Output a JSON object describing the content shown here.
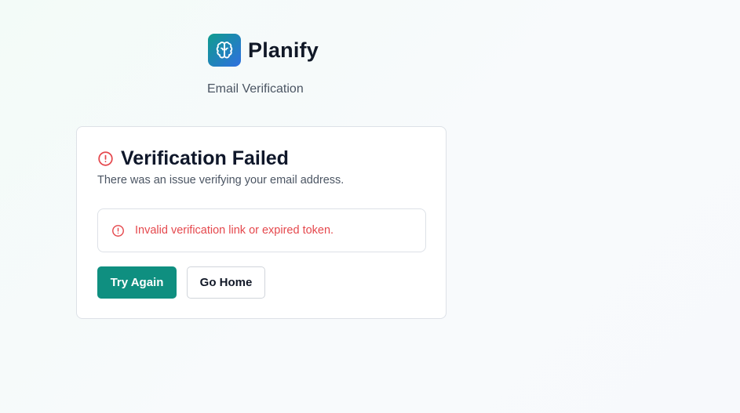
{
  "brand": {
    "name": "Planify",
    "logo_icon": "brain-icon",
    "logo_colors": [
      "#0f9c8e",
      "#2f6fe0"
    ]
  },
  "page": {
    "subtitle": "Email Verification"
  },
  "card": {
    "title": "Verification Failed",
    "title_icon": "alert-circle-icon",
    "description": "There was an issue verifying your email address.",
    "alert": {
      "icon": "alert-circle-icon",
      "message": "Invalid verification link or expired token."
    },
    "buttons": {
      "primary_label": "Try Again",
      "secondary_label": "Go Home"
    }
  },
  "colors": {
    "error": "#e5484d",
    "primary": "#0f8f80"
  }
}
